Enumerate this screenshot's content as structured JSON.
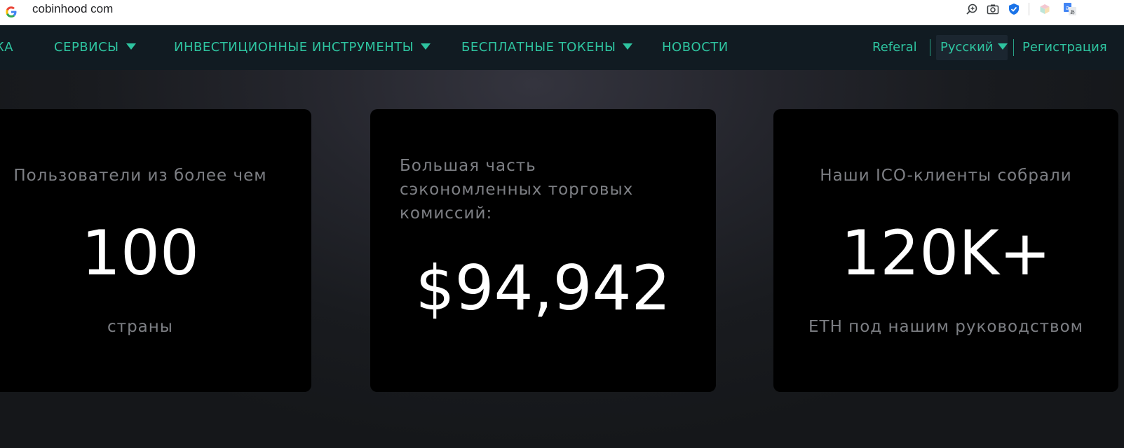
{
  "browser": {
    "url": "cobinhood com"
  },
  "nav": {
    "items": [
      {
        "label": "КА",
        "has_dropdown": false
      },
      {
        "label": "СЕРВИСЫ",
        "has_dropdown": true
      },
      {
        "label": "ИНВЕСТИЦИОННЫЕ ИНСТРУМЕНТЫ",
        "has_dropdown": true
      },
      {
        "label": "БЕСПЛАТНЫЕ ТОКЕНЫ",
        "has_dropdown": true
      },
      {
        "label": "НОВОСТИ",
        "has_dropdown": false
      }
    ],
    "referal": "Referal",
    "language": "Русский",
    "register": "Регистрация"
  },
  "stats": [
    {
      "top_label": "Пользователи из более чем",
      "value": "100",
      "bottom_label": "страны"
    },
    {
      "top_label_lines": [
        "Большая часть",
        "сэкономленных торговых",
        "комиссий:"
      ],
      "value": "$94,942"
    },
    {
      "top_label": "Наши ICO-клиенты собрали",
      "value": "120K+",
      "bottom_label": "ETH под нашим руководством"
    }
  ],
  "colors": {
    "accent": "#2ec4a0",
    "nav_bg": "#111b22",
    "card_bg": "#000000",
    "label": "#7d7f84",
    "value": "#ffffff"
  }
}
